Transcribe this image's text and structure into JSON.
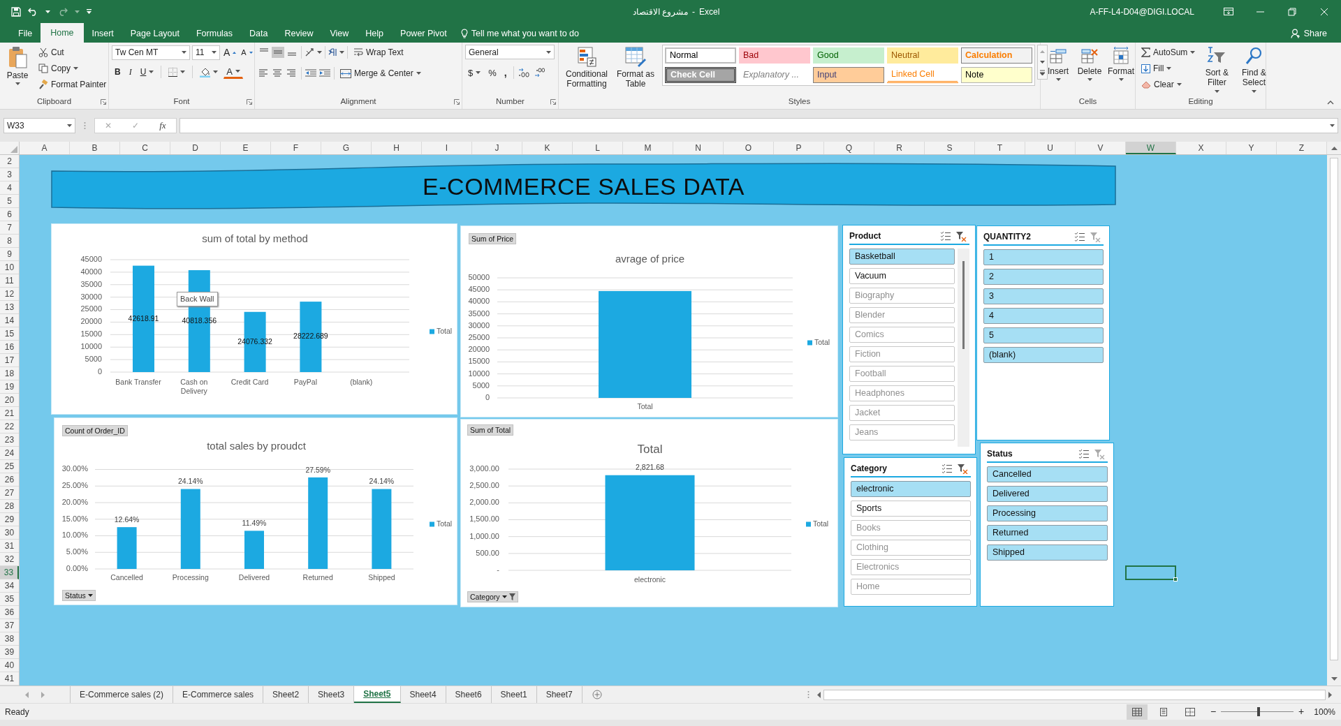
{
  "title_bar": {
    "workbook": "مشروع الاقتصاد",
    "separator": "-",
    "app": "Excel",
    "user": "A-FF-L4-D04@DIGI.LOCAL"
  },
  "ribbon_tabs": [
    {
      "label": "File",
      "selected": false
    },
    {
      "label": "Home",
      "selected": true
    },
    {
      "label": "Insert",
      "selected": false
    },
    {
      "label": "Page Layout",
      "selected": false
    },
    {
      "label": "Formulas",
      "selected": false
    },
    {
      "label": "Data",
      "selected": false
    },
    {
      "label": "Review",
      "selected": false
    },
    {
      "label": "View",
      "selected": false
    },
    {
      "label": "Help",
      "selected": false
    },
    {
      "label": "Power Pivot",
      "selected": false
    }
  ],
  "tell_me": {
    "placeholder": "Tell me what you want to do"
  },
  "share": "Share",
  "ribbon": {
    "groups": [
      {
        "kind": "clipboard",
        "label": "Clipboard",
        "paste": "Paste",
        "cut": "Cut",
        "copy": "Copy",
        "format_painter": "Format Painter"
      },
      {
        "kind": "font",
        "label": "Font",
        "font_name": "Tw Cen MT",
        "font_size": "11",
        "grow": "A",
        "shrink": "A",
        "bold": "B",
        "italic": "I",
        "underline": "U",
        "font_color": "A"
      },
      {
        "kind": "alignment",
        "label": "Alignment",
        "wrap_text": "Wrap Text",
        "merge": "Merge & Center",
        "vertical_align": [
          {
            "selected": false
          },
          {
            "selected": true
          },
          {
            "selected": false
          }
        ]
      },
      {
        "kind": "number",
        "label": "Number",
        "format": "General",
        "currency": "$",
        "percent": "%",
        "comma": ","
      },
      {
        "kind": "styles",
        "label": "Styles",
        "conditional": "Conditional Formatting",
        "format_table": "Format as Table",
        "cell_styles": [
          {
            "label": "Normal",
            "kind": "normal"
          },
          {
            "label": "Bad",
            "kind": "bad"
          },
          {
            "label": "Good",
            "kind": "good"
          },
          {
            "label": "Neutral",
            "kind": "neutral"
          },
          {
            "label": "Calculation",
            "kind": "calculation"
          },
          {
            "label": "Check Cell",
            "kind": "check"
          },
          {
            "label": "Explanatory ...",
            "kind": "explanatory"
          },
          {
            "label": "Input",
            "kind": "input"
          },
          {
            "label": "Linked Cell",
            "kind": "linked"
          },
          {
            "label": "Note",
            "kind": "note"
          }
        ]
      },
      {
        "kind": "cells",
        "label": "Cells",
        "buttons": [
          "Insert",
          "Delete",
          "Format"
        ]
      },
      {
        "kind": "editing",
        "label": "Editing",
        "autosum": "AutoSum",
        "fill": "Fill",
        "clear": "Clear",
        "sort": "Sort & Filter",
        "find": "Find & Select"
      }
    ]
  },
  "formula_bar": {
    "name_box": "W33",
    "cancel": "✕",
    "enter": "✓",
    "function": "fx"
  },
  "sheet": {
    "columns": [
      {
        "label": "A",
        "selected": false
      },
      {
        "label": "B",
        "selected": false
      },
      {
        "label": "C",
        "selected": false
      },
      {
        "label": "D",
        "selected": false
      },
      {
        "label": "E",
        "selected": false
      },
      {
        "label": "F",
        "selected": false
      },
      {
        "label": "G",
        "selected": false
      },
      {
        "label": "H",
        "selected": false
      },
      {
        "label": "I",
        "selected": false
      },
      {
        "label": "J",
        "selected": false
      },
      {
        "label": "K",
        "selected": false
      },
      {
        "label": "L",
        "selected": false
      },
      {
        "label": "M",
        "selected": false
      },
      {
        "label": "N",
        "selected": false
      },
      {
        "label": "O",
        "selected": false
      },
      {
        "label": "P",
        "selected": false
      },
      {
        "label": "Q",
        "selected": false
      },
      {
        "label": "R",
        "selected": false
      },
      {
        "label": "S",
        "selected": false
      },
      {
        "label": "T",
        "selected": false
      },
      {
        "label": "U",
        "selected": false
      },
      {
        "label": "V",
        "selected": false
      },
      {
        "label": "W",
        "selected": true
      },
      {
        "label": "X",
        "selected": false
      },
      {
        "label": "Y",
        "selected": false
      },
      {
        "label": "Z",
        "selected": false
      }
    ],
    "rows": [
      {
        "label": "2",
        "selected": false
      },
      {
        "label": "3",
        "selected": false
      },
      {
        "label": "4",
        "selected": false
      },
      {
        "label": "5",
        "selected": false
      },
      {
        "label": "6",
        "selected": false
      },
      {
        "label": "7",
        "selected": false
      },
      {
        "label": "8",
        "selected": false
      },
      {
        "label": "9",
        "selected": false
      },
      {
        "label": "10",
        "selected": false
      },
      {
        "label": "11",
        "selected": false
      },
      {
        "label": "12",
        "selected": false
      },
      {
        "label": "13",
        "selected": false
      },
      {
        "label": "14",
        "selected": false
      },
      {
        "label": "15",
        "selected": false
      },
      {
        "label": "16",
        "selected": false
      },
      {
        "label": "17",
        "selected": false
      },
      {
        "label": "18",
        "selected": false
      },
      {
        "label": "19",
        "selected": false
      },
      {
        "label": "20",
        "selected": false
      },
      {
        "label": "21",
        "selected": false
      },
      {
        "label": "22",
        "selected": false
      },
      {
        "label": "23",
        "selected": false
      },
      {
        "label": "24",
        "selected": false
      },
      {
        "label": "25",
        "selected": false
      },
      {
        "label": "26",
        "selected": false
      },
      {
        "label": "27",
        "selected": false
      },
      {
        "label": "28",
        "selected": false
      },
      {
        "label": "29",
        "selected": false
      },
      {
        "label": "30",
        "selected": false
      },
      {
        "label": "31",
        "selected": false
      },
      {
        "label": "32",
        "selected": false
      },
      {
        "label": "33",
        "selected": true
      },
      {
        "label": "34",
        "selected": false
      },
      {
        "label": "35",
        "selected": false
      },
      {
        "label": "36",
        "selected": false
      },
      {
        "label": "37",
        "selected": false
      },
      {
        "label": "38",
        "selected": false
      },
      {
        "label": "39",
        "selected": false
      },
      {
        "label": "40",
        "selected": false
      },
      {
        "label": "41",
        "selected": false
      }
    ]
  },
  "dashboard": {
    "banner": "E-COMMERCE SALES DATA",
    "charts": [
      {
        "kind": "perspective",
        "tooltip": "Back Wall",
        "chart_data": {
          "type": "bar",
          "title": "sum of total by method",
          "grid": true,
          "categories": [
            "Bank Transfer",
            "Cash on Delivery",
            "Credit Card",
            "PayPal",
            "(blank)"
          ],
          "ylim": [
            0,
            45000
          ],
          "yticks": [
            0,
            5000,
            10000,
            15000,
            20000,
            25000,
            30000,
            35000,
            40000,
            45000
          ],
          "value_labels": [
            "42618.91",
            "40818.356",
            "24076.332",
            "28222.689"
          ],
          "series": [
            {
              "name": "Total",
              "color": "#1ca9e1",
              "values": [
                42600,
                40800,
                24100,
                28200,
                null
              ]
            }
          ]
        }
      },
      {
        "kind": "flat",
        "field_buttons": [
          {
            "label": "Sum of Price",
            "kind": "value"
          }
        ],
        "chart_data": {
          "type": "bar",
          "title": "avrage of price",
          "grid": true,
          "categories": [
            "Total"
          ],
          "ylim": [
            0,
            50000
          ],
          "yticks": [
            0,
            5000,
            10000,
            15000,
            20000,
            25000,
            30000,
            35000,
            40000,
            45000,
            50000
          ],
          "series": [
            {
              "name": "Total",
              "color": "#1ca9e1",
              "values": [
                44500
              ]
            }
          ]
        }
      },
      {
        "kind": "flat",
        "field_buttons": [
          {
            "label": "Count of Order_ID",
            "kind": "value"
          },
          {
            "label": "Status",
            "kind": "axis",
            "filtered": false
          }
        ],
        "chart_data": {
          "type": "bar",
          "title": "total sales by proudct",
          "grid": true,
          "categories": [
            "Cancelled",
            "Processing",
            "Delivered",
            "Returned",
            "Shipped"
          ],
          "ylim": [
            0,
            0.3
          ],
          "yticks": [
            {
              "value": 0,
              "label": "0.00%"
            },
            {
              "value": 0.05,
              "label": "5.00%"
            },
            {
              "value": 0.1,
              "label": "10.00%"
            },
            {
              "value": 0.15,
              "label": "15.00%"
            },
            {
              "value": 0.2,
              "label": "20.00%"
            },
            {
              "value": 0.25,
              "label": "25.00%"
            },
            {
              "value": 0.3,
              "label": "30.00%"
            }
          ],
          "value_labels": [
            "12.64%",
            "24.14%",
            "11.49%",
            "27.59%",
            "24.14%"
          ],
          "series": [
            {
              "name": "Total",
              "color": "#1ca9e1",
              "values": [
                0.126,
                0.241,
                0.115,
                0.276,
                0.241
              ]
            }
          ]
        }
      },
      {
        "kind": "flat",
        "field_buttons": [
          {
            "label": "Sum of Total",
            "kind": "value"
          },
          {
            "label": "Category",
            "kind": "axis",
            "filtered": true
          }
        ],
        "chart_data": {
          "type": "bar",
          "title": "Total",
          "grid": true,
          "categories": [
            "electronic"
          ],
          "ylim": [
            0,
            3000
          ],
          "yticks": [
            {
              "value": 0,
              "label": "-"
            },
            {
              "value": 500,
              "label": "500.00"
            },
            {
              "value": 1000,
              "label": "1,000.00"
            },
            {
              "value": 1500,
              "label": "1,500.00"
            },
            {
              "value": 2000,
              "label": "2,000.00"
            },
            {
              "value": 2500,
              "label": "2,500.00"
            },
            {
              "value": 3000,
              "label": "3,000.00"
            }
          ],
          "value_labels": [
            "2,821.68"
          ],
          "series": [
            {
              "name": "Total",
              "color": "#1ca9e1",
              "values": [
                2820
              ]
            }
          ]
        }
      }
    ],
    "slicers": [
      {
        "title": "Product",
        "filtered": true,
        "scrollable": true,
        "items": [
          {
            "label": "Basketball",
            "selected": true,
            "disabled": false
          },
          {
            "label": "Vacuum",
            "selected": false,
            "disabled": false
          },
          {
            "label": "Biography",
            "selected": false,
            "disabled": true
          },
          {
            "label": "Blender",
            "selected": false,
            "disabled": true
          },
          {
            "label": "Comics",
            "selected": false,
            "disabled": true
          },
          {
            "label": "Fiction",
            "selected": false,
            "disabled": true
          },
          {
            "label": "Football",
            "selected": false,
            "disabled": true
          },
          {
            "label": "Headphones",
            "selected": false,
            "disabled": true
          },
          {
            "label": "Jacket",
            "selected": false,
            "disabled": true
          },
          {
            "label": "Jeans",
            "selected": false,
            "disabled": true
          }
        ]
      },
      {
        "title": "Category",
        "filtered": true,
        "scrollable": false,
        "items": [
          {
            "label": "electronic",
            "selected": true,
            "disabled": false
          },
          {
            "label": "Sports",
            "selected": false,
            "disabled": false
          },
          {
            "label": "Books",
            "selected": false,
            "disabled": true
          },
          {
            "label": "Clothing",
            "selected": false,
            "disabled": true
          },
          {
            "label": "Electronics",
            "selected": false,
            "disabled": true
          },
          {
            "label": "Home",
            "selected": false,
            "disabled": true
          }
        ]
      },
      {
        "title": "QUANTITY2",
        "filtered": false,
        "scrollable": false,
        "items": [
          {
            "label": "1",
            "selected": true,
            "disabled": false
          },
          {
            "label": "2",
            "selected": true,
            "disabled": false
          },
          {
            "label": "3",
            "selected": true,
            "disabled": false
          },
          {
            "label": "4",
            "selected": true,
            "disabled": false
          },
          {
            "label": "5",
            "selected": true,
            "disabled": false
          },
          {
            "label": "(blank)",
            "selected": true,
            "disabled": false
          }
        ]
      },
      {
        "title": "Status",
        "filtered": false,
        "scrollable": false,
        "items": [
          {
            "label": "Cancelled",
            "selected": true,
            "disabled": false
          },
          {
            "label": "Delivered",
            "selected": true,
            "disabled": false
          },
          {
            "label": "Processing",
            "selected": true,
            "disabled": false
          },
          {
            "label": "Returned",
            "selected": true,
            "disabled": false
          },
          {
            "label": "Shipped",
            "selected": true,
            "disabled": false
          }
        ]
      }
    ]
  },
  "sheet_tabs": [
    {
      "label": "E-Commerce sales (2)",
      "selected": false
    },
    {
      "label": "E-Commerce sales",
      "selected": false
    },
    {
      "label": "Sheet2",
      "selected": false
    },
    {
      "label": "Sheet3",
      "selected": false
    },
    {
      "label": "Sheet5",
      "selected": true
    },
    {
      "label": "Sheet4",
      "selected": false
    },
    {
      "label": "Sheet6",
      "selected": false
    },
    {
      "label": "Sheet1",
      "selected": false
    },
    {
      "label": "Sheet7",
      "selected": false
    }
  ],
  "status_bar": {
    "status": "Ready",
    "views": [
      {
        "selected": true
      },
      {
        "selected": false
      },
      {
        "selected": false
      }
    ],
    "zoom_out": "−",
    "zoom_in": "+",
    "zoom_slider": {
      "level": 0.5
    },
    "zoom": "100%"
  }
}
